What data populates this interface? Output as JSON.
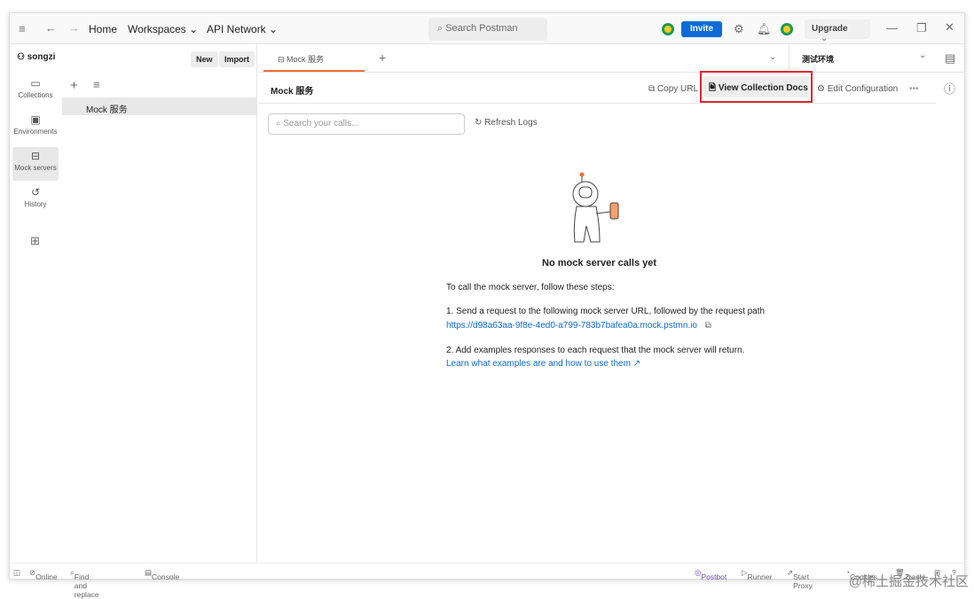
{
  "titlebar": {
    "home": "Home",
    "workspaces": "Workspaces",
    "api_network": "API Network",
    "search_placeholder": "Search Postman",
    "invite": "Invite",
    "upgrade": "Upgrade"
  },
  "sidebar": {
    "user": "songzi",
    "new": "New",
    "import": "Import",
    "nav": [
      {
        "label": "Collections"
      },
      {
        "label": "Environments"
      },
      {
        "label": "Mock servers"
      },
      {
        "label": "History"
      }
    ],
    "items": [
      "Mock 服务"
    ]
  },
  "tabs": [
    {
      "label": "Mock 服务"
    }
  ],
  "environment": "测试环境",
  "header": {
    "title": "Mock 服务",
    "copy_url": "Copy URL",
    "view_docs": "View Collection Docs",
    "edit_config": "Edit Configuration"
  },
  "main": {
    "search_placeholder": "Search your calls...",
    "refresh": "Refresh Logs",
    "empty_title": "No mock server calls yet",
    "intro": "To call the mock server, follow these steps:",
    "step1": "1. Send a request to the following mock server URL, followed by the request path",
    "url": "https://d98a63aa-9f8e-4ed0-a799-783b7bafea0a.mock.pstmn.io",
    "step2": "2. Add examples responses to each request that the mock server will return.",
    "learn": "Learn what examples are and how to use them ↗"
  },
  "statusbar": {
    "online": "Online",
    "find": "Find and replace",
    "console": "Console",
    "postbot": "Postbot",
    "runner": "Runner",
    "proxy": "Start Proxy",
    "cookies": "Cookies",
    "trash": "Trash"
  },
  "watermark": "@稀土掘金技术社区"
}
